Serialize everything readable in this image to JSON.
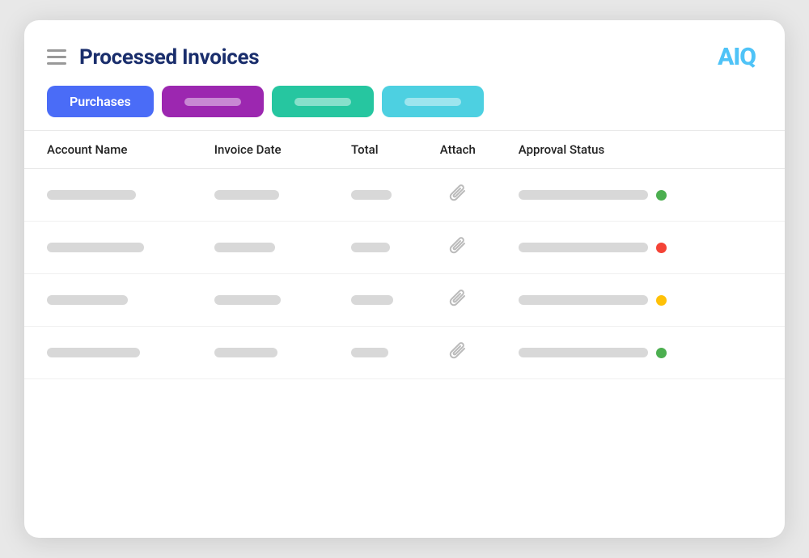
{
  "header": {
    "title": "Processed Invoices",
    "logo_text": "AI",
    "logo_accent": "Q"
  },
  "tabs": [
    {
      "id": "purchases",
      "label": "Purchases",
      "active": true,
      "color": "#4a6cf7"
    },
    {
      "id": "tab2",
      "label": "",
      "active": false,
      "color": "#9c27b0"
    },
    {
      "id": "tab3",
      "label": "",
      "active": false,
      "color": "#26c6a0"
    },
    {
      "id": "tab4",
      "label": "",
      "active": false,
      "color": "#4dd0e1"
    }
  ],
  "table": {
    "columns": [
      {
        "id": "account",
        "label": "Account Name"
      },
      {
        "id": "date",
        "label": "Invoice Date"
      },
      {
        "id": "total",
        "label": "Total"
      },
      {
        "id": "attach",
        "label": "Attach"
      },
      {
        "id": "status",
        "label": "Approval Status"
      }
    ],
    "rows": [
      {
        "status_dot": "green"
      },
      {
        "status_dot": "red"
      },
      {
        "status_dot": "yellow"
      },
      {
        "status_dot": "green"
      }
    ]
  },
  "icons": {
    "hamburger": "☰",
    "paperclip": "🖇"
  }
}
